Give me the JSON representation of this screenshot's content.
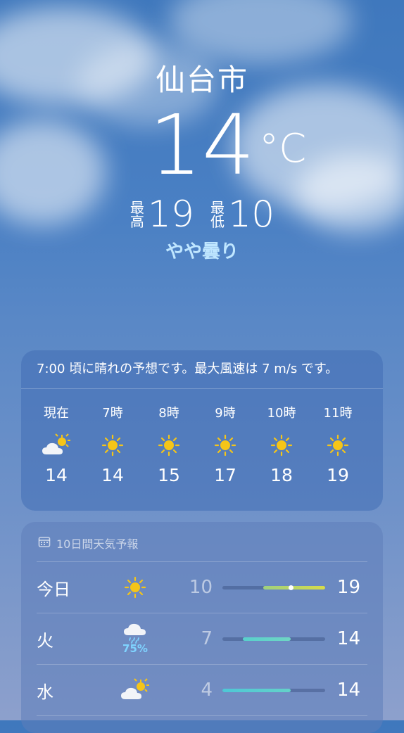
{
  "location": {
    "city": "仙台市"
  },
  "current": {
    "temp": "14",
    "unit": "°C",
    "high_label": "最高",
    "high": "19",
    "low_label": "最低",
    "low": "10",
    "condition": "やや曇り"
  },
  "hourly": {
    "summary": "7:00 頃に晴れの予想です。最大風速は 7 m/s です。",
    "items": [
      {
        "label": "現在",
        "icon": "partly-cloudy-icon",
        "temp": "14"
      },
      {
        "label": "7時",
        "icon": "sun-icon",
        "temp": "14"
      },
      {
        "label": "8時",
        "icon": "sun-icon",
        "temp": "15"
      },
      {
        "label": "9時",
        "icon": "sun-icon",
        "temp": "17"
      },
      {
        "label": "10時",
        "icon": "sun-icon",
        "temp": "18"
      },
      {
        "label": "11時",
        "icon": "sun-icon",
        "temp": "19"
      }
    ]
  },
  "daily": {
    "header": "10日間天気予報",
    "range": {
      "min": 4,
      "max": 19
    },
    "items": [
      {
        "day": "今日",
        "icon": "sun-icon",
        "precip": "",
        "low": "10",
        "high": "19",
        "current": 14,
        "colors": [
          "#9fd07f",
          "#d7dc4a"
        ]
      },
      {
        "day": "火",
        "icon": "rain-cloud-icon",
        "precip": "75%",
        "low": "7",
        "high": "14",
        "colors": [
          "#58d0cc",
          "#6fd6c4"
        ]
      },
      {
        "day": "水",
        "icon": "partly-cloudy-icon",
        "precip": "",
        "low": "4",
        "high": "14",
        "colors": [
          "#4ec7d6",
          "#64d2c9"
        ]
      }
    ]
  }
}
